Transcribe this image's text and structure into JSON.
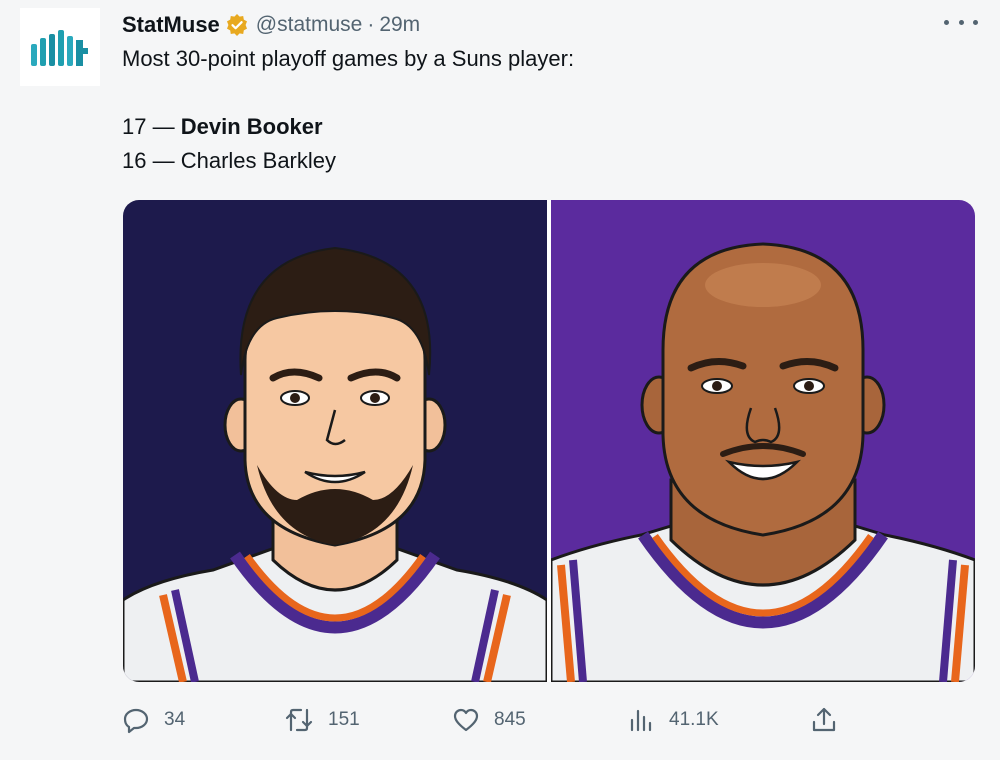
{
  "author": {
    "display_name": "StatMuse",
    "handle": "@statmuse",
    "separator": "·",
    "time": "29m",
    "avatar_icon": "statmuse-logo-icon",
    "verified_icon": "verified-badge-icon",
    "verified_color": "#e8a920"
  },
  "tweet": {
    "intro": "Most 30-point playoff games by a Suns player:",
    "rows": [
      {
        "count": "17",
        "dash": " — ",
        "name": "Devin Booker"
      },
      {
        "count": "16",
        "dash": " — ",
        "name": "Charles Barkley"
      }
    ]
  },
  "media": {
    "left_player_icon": "devin-booker-illustration",
    "right_player_icon": "charles-barkley-illustration",
    "left_bg": "#1d1a4c",
    "right_bg": "#5b2b9e"
  },
  "actions": {
    "reply_count": "34",
    "retweet_count": "151",
    "like_count": "845",
    "views_count": "41.1K",
    "icons": [
      "reply-icon",
      "retweet-icon",
      "like-icon",
      "views-icon",
      "share-icon"
    ]
  },
  "colors": {
    "text_primary": "#0f1419",
    "text_secondary": "#536471",
    "logo_teal": "#1f9fb0"
  }
}
